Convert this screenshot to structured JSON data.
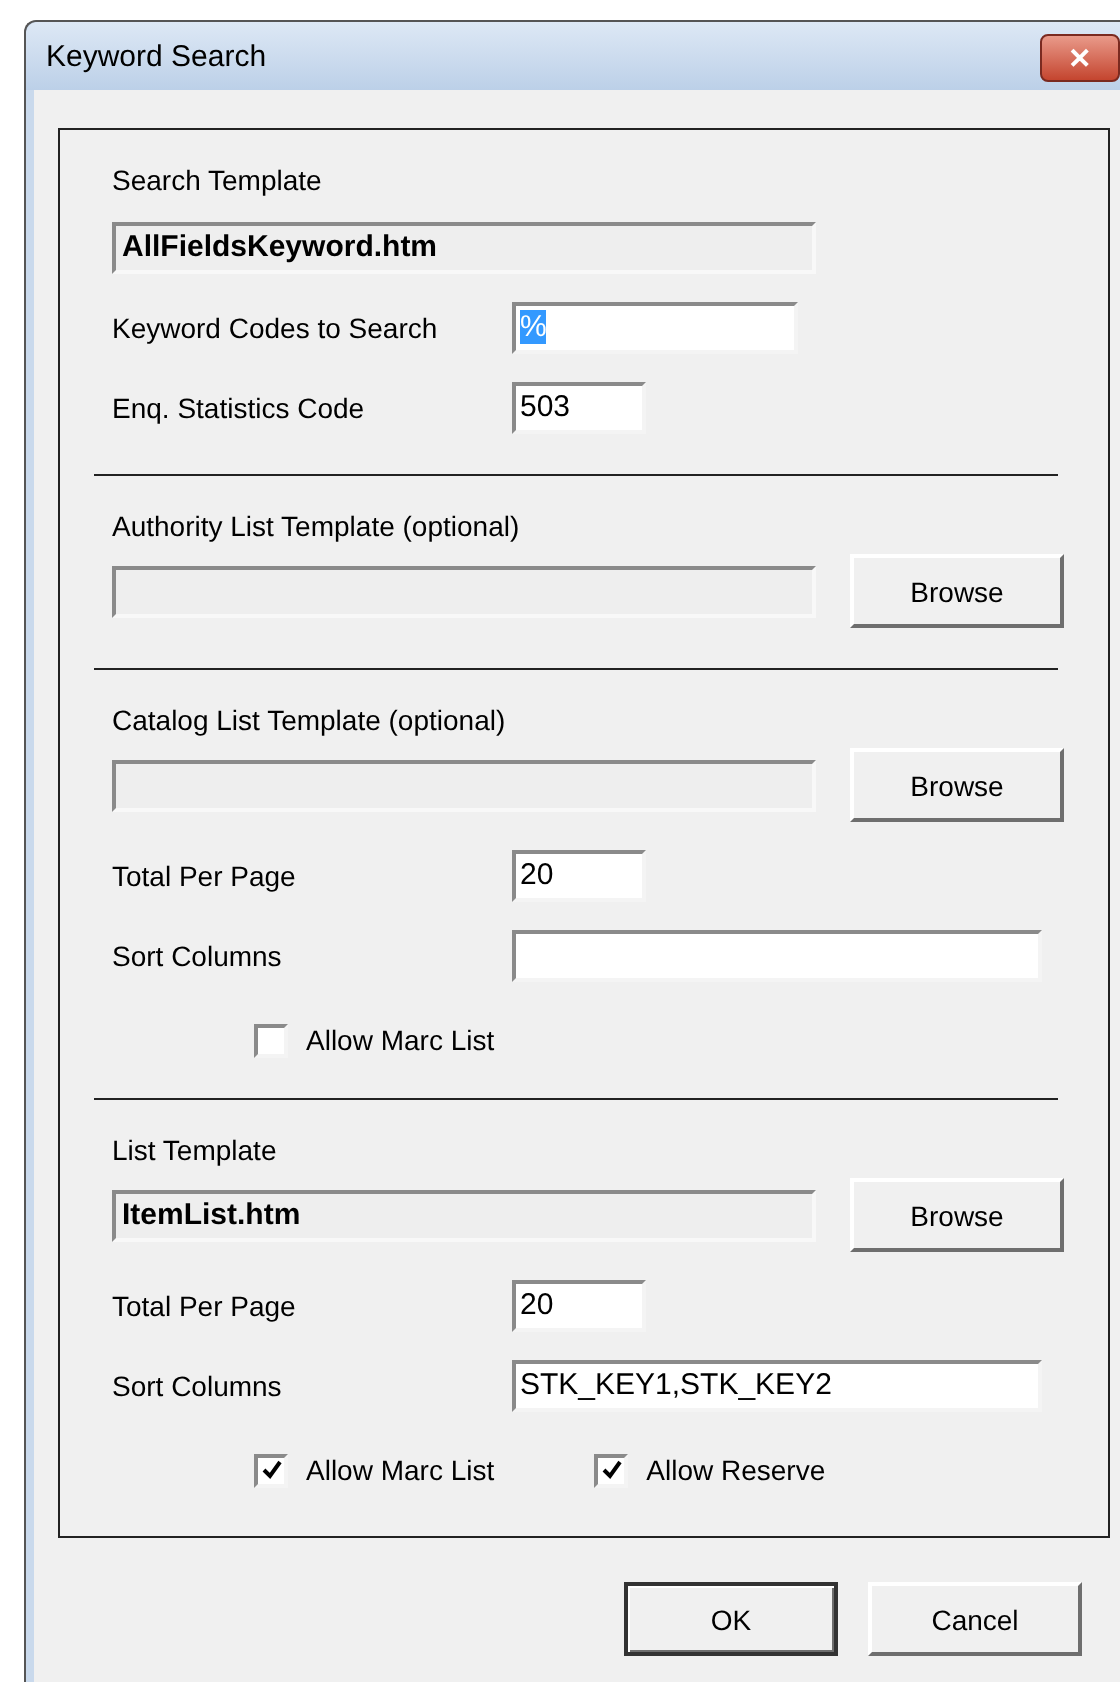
{
  "window": {
    "title": "Keyword Search",
    "close": "✕"
  },
  "sections": [
    {
      "items": [
        {
          "kind": "label",
          "text": "Search Template"
        },
        {
          "kind": "readonly",
          "value": "AllFieldsKeyword.htm"
        },
        {
          "kind": "code-field",
          "label": "Keyword Codes to Search",
          "value": "%",
          "text_selected": true
        },
        {
          "kind": "number-field",
          "label": "Enq. Statistics Code",
          "value": "503"
        }
      ]
    },
    {
      "items": [
        {
          "kind": "label",
          "text": "Authority List Template (optional)"
        },
        {
          "kind": "readonly",
          "browse": "Browse"
        }
      ]
    },
    {
      "items": [
        {
          "kind": "label",
          "text": "Catalog List Template (optional)"
        },
        {
          "kind": "readonly",
          "browse": "Browse"
        },
        {
          "kind": "number-field",
          "label": "Total Per Page",
          "value": "20"
        },
        {
          "kind": "wide-field",
          "label": "Sort Columns"
        },
        {
          "kind": "checks",
          "boxes": [
            {
              "label": "Allow Marc List",
              "checked": false
            }
          ]
        }
      ]
    },
    {
      "items": [
        {
          "kind": "label",
          "text": "List Template"
        },
        {
          "kind": "readonly",
          "value": "ItemList.htm",
          "browse": "Browse"
        },
        {
          "kind": "number-field",
          "label": "Total Per Page",
          "value": "20"
        },
        {
          "kind": "wide-field",
          "label": "Sort Columns",
          "value": "STK_KEY1,STK_KEY2"
        },
        {
          "kind": "checks",
          "boxes": [
            {
              "label": "Allow Marc List",
              "checked": true
            },
            {
              "label": "Allow Reserve",
              "checked": true
            }
          ]
        }
      ]
    }
  ],
  "buttons": [
    "OK",
    "Cancel"
  ]
}
